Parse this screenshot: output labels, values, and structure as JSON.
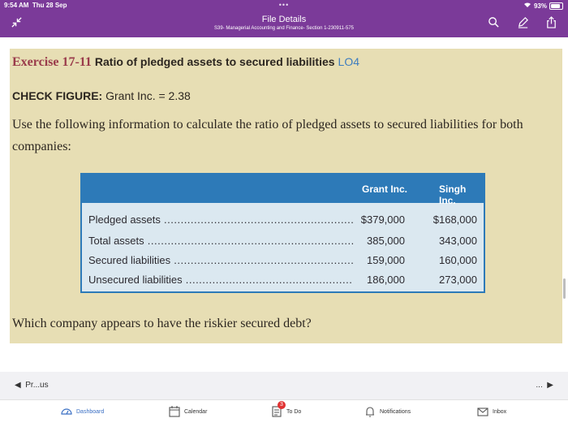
{
  "status_bar": {
    "time": "9:54 AM",
    "date": "Thu 28 Sep",
    "battery": "93%"
  },
  "header": {
    "title": "File Details",
    "subtitle": "S39- Managerial Accounting and Finance- Section 1-230911-575",
    "icons": [
      "collapse-icon",
      "search-icon",
      "annotate-pen-icon",
      "share-icon"
    ]
  },
  "document": {
    "exercise_number": "Exercise 17-11",
    "exercise_title": "Ratio of pledged assets to secured liabilities",
    "learning_objective": "LO4",
    "check_label": "CHECK FIGURE:",
    "check_value": "Grant Inc. = 2.38",
    "instruction": "Use the following information to calculate the ratio of pledged assets to secured liabilities for both companies:",
    "table": {
      "columns": [
        "Grant Inc.",
        "Singh Inc."
      ],
      "rows": [
        {
          "label": "Pledged assets",
          "grant": "$379,000",
          "singh": "$168,000"
        },
        {
          "label": "Total assets",
          "grant": "385,000",
          "singh": "343,000"
        },
        {
          "label": "Secured liabilities",
          "grant": "159,000",
          "singh": "160,000"
        },
        {
          "label": "Unsecured liabilities",
          "grant": "186,000",
          "singh": "273,000"
        }
      ]
    },
    "question": "Which company appears to have the riskier secured debt?"
  },
  "pager": {
    "prev_label": "Pr...us",
    "next_label": "..."
  },
  "tabbar": {
    "dashboard": "Dashboard",
    "calendar": "Calendar",
    "todo": "To Do",
    "todo_badge": "3",
    "notifications": "Notifications",
    "inbox": "Inbox"
  },
  "colors": {
    "header": "#7b3a99",
    "table_header": "#2d7ab8",
    "page_bg": "#e7deb4",
    "active_tab": "#3a6fc4"
  }
}
